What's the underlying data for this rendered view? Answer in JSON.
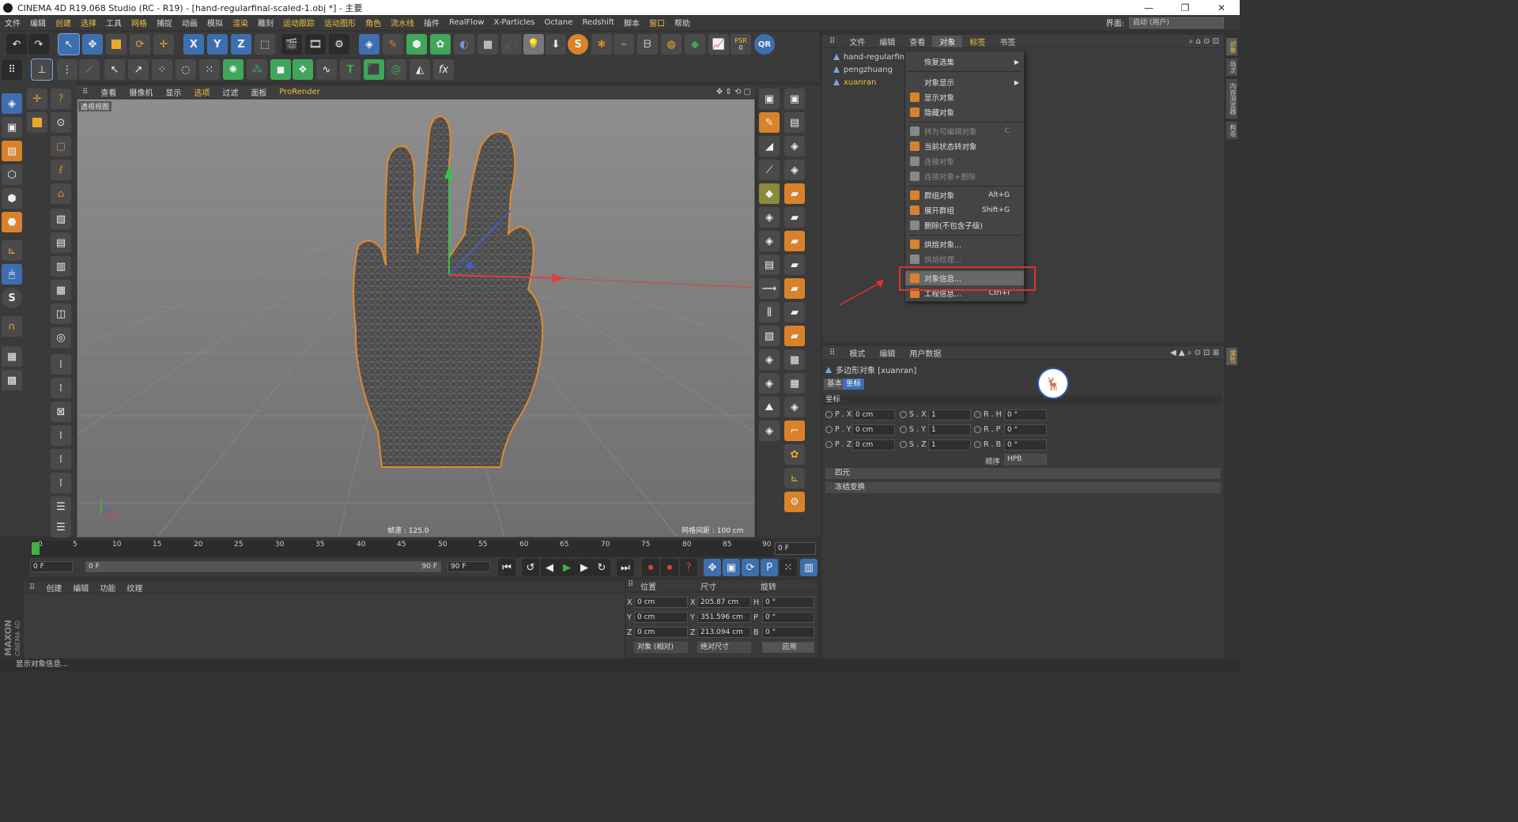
{
  "window": {
    "title": "CINEMA 4D R19.068 Studio (RC - R19) - [hand-regularfinal-scaled-1.obj *] - 主要",
    "controls": [
      "—",
      "❐",
      "✕"
    ]
  },
  "menubar": {
    "items": [
      "文件",
      "编辑",
      "创建",
      "选择",
      "工具",
      "网格",
      "捕捉",
      "动画",
      "模拟",
      "渲染",
      "雕刻",
      "运动跟踪",
      "运动图形",
      "角色",
      "流水线",
      "插件",
      "RealFlow",
      "X-Particles",
      "Octane",
      "Redshift",
      "脚本",
      "窗口",
      "帮助"
    ],
    "layout_label": "界面:",
    "layout_value": "启动 (用户)"
  },
  "viewport": {
    "menu": [
      "查看",
      "摄像机",
      "显示",
      "选项",
      "过滤",
      "面板",
      "ProRender"
    ],
    "view_label": "透视视图",
    "fps": "帧速 : 125.0",
    "grid_spacing": "网格间距 : 100 cm"
  },
  "toolbar_top": {
    "psr_label": "PSR",
    "psr_value": "0",
    "qr_label": "QR",
    "axis_x": "X",
    "axis_y": "Y",
    "axis_z": "Z",
    "s_label": "S",
    "t_label": "T",
    "fx_label": "fx"
  },
  "object_manager": {
    "tabs": [
      "文件",
      "编辑",
      "查看",
      "对象",
      "标签",
      "书签"
    ],
    "active_tab": "对象",
    "objects": [
      {
        "name": "hand-regularfinal",
        "selected": false
      },
      {
        "name": "pengzhuang",
        "selected": false
      },
      {
        "name": "xuanran",
        "selected": true
      }
    ]
  },
  "context_menu": {
    "items": [
      {
        "label": "恢复选集",
        "shortcut": "",
        "submenu": true,
        "disabled": false
      },
      {
        "label": "对象显示",
        "shortcut": "",
        "submenu": true,
        "disabled": false
      },
      {
        "label": "显示对象",
        "shortcut": "",
        "submenu": false,
        "disabled": false
      },
      {
        "label": "隐藏对象",
        "shortcut": "",
        "submenu": false,
        "disabled": false
      },
      {
        "label": "转为可编辑对象",
        "shortcut": "C",
        "submenu": false,
        "disabled": true
      },
      {
        "label": "当前状态转对象",
        "shortcut": "",
        "submenu": false,
        "disabled": false
      },
      {
        "label": "连接对象",
        "shortcut": "",
        "submenu": false,
        "disabled": true
      },
      {
        "label": "连接对象+删除",
        "shortcut": "",
        "submenu": false,
        "disabled": true
      },
      {
        "label": "群组对象",
        "shortcut": "Alt+G",
        "submenu": false,
        "disabled": false
      },
      {
        "label": "展开群组",
        "shortcut": "Shift+G",
        "submenu": false,
        "disabled": false
      },
      {
        "label": "删除(不包含子级)",
        "shortcut": "",
        "submenu": false,
        "disabled": false
      },
      {
        "label": "烘焙对象...",
        "shortcut": "",
        "submenu": false,
        "disabled": false
      },
      {
        "label": "烘焙纹理...",
        "shortcut": "",
        "submenu": false,
        "disabled": true
      },
      {
        "label": "对象信息...",
        "shortcut": "",
        "submenu": false,
        "disabled": false,
        "highlighted": true
      },
      {
        "label": "工程信息...",
        "shortcut": "Ctrl+I",
        "submenu": false,
        "disabled": false
      }
    ]
  },
  "attribute_manager": {
    "tabs": [
      "模式",
      "编辑",
      "用户数据"
    ],
    "object_title": "多边形对象 [xuanran]",
    "sub_tabs": [
      "基本",
      "坐标"
    ],
    "active_sub_tab": "坐标",
    "section_title": "坐标",
    "fields": {
      "px_label": "P . X",
      "px": "0 cm",
      "py_label": "P . Y",
      "py": "0 cm",
      "pz_label": "P . Z",
      "pz": "0 cm",
      "sx_label": "S . X",
      "sx": "1",
      "sy_label": "S . Y",
      "sy": "1",
      "sz_label": "S . Z",
      "sz": "1",
      "rh_label": "R . H",
      "rh": "0 °",
      "rp_label": "R . P",
      "rp": "0 °",
      "rb_label": "R . B",
      "rb": "0 °",
      "order_label": "顺序",
      "order": "HPB"
    },
    "collapsed_sections": [
      "四元",
      "冻结变换"
    ]
  },
  "timeline": {
    "ticks": [
      "0",
      "5",
      "10",
      "15",
      "20",
      "25",
      "30",
      "35",
      "40",
      "45",
      "50",
      "55",
      "60",
      "65",
      "70",
      "75",
      "80",
      "85",
      "90"
    ],
    "current_frame": "0 F",
    "start": "0 F",
    "range_start": "0 F",
    "range_end": "90 F",
    "end": "90 F"
  },
  "material_manager": {
    "tabs": [
      "创建",
      "编辑",
      "功能",
      "纹理"
    ]
  },
  "coordinates": {
    "headers": [
      "位置",
      "尺寸",
      "旋转"
    ],
    "rows": [
      {
        "axis": "X",
        "pos": "0 cm",
        "size_axis": "X",
        "size": "205.87 cm",
        "rot_axis": "H",
        "rot": "0 °"
      },
      {
        "axis": "Y",
        "pos": "0 cm",
        "size_axis": "Y",
        "size": "351.596 cm",
        "rot_axis": "P",
        "rot": "0 °"
      },
      {
        "axis": "Z",
        "pos": "0 cm",
        "size_axis": "Z",
        "size": "213.094 cm",
        "rot_axis": "B",
        "rot": "0 °"
      }
    ],
    "mode1": "对象 (相对)",
    "mode2": "绝对尺寸",
    "apply": "应用"
  },
  "branding": {
    "maxon": "MAXON",
    "c4d": "CINEMA 4D"
  },
  "status": {
    "text": "显示对象信息..."
  },
  "side_tabs": [
    "对象",
    "场次",
    "内容浏览器",
    "构造"
  ],
  "side_tabs_bottom": [
    "属性"
  ],
  "colors": {
    "accent": "#f0c040",
    "selection_border": "#e03030",
    "tool_blue": "#3d6fb0",
    "tool_orange": "#d9822b"
  }
}
